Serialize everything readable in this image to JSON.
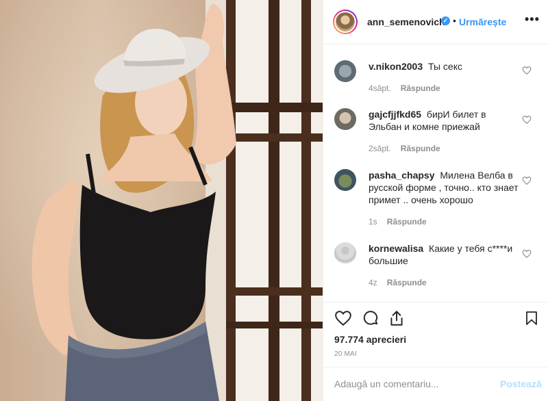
{
  "header": {
    "username": "ann_semenovich",
    "verified_icon": "verified-badge-icon",
    "separator": "•",
    "follow_label": "Urmărește",
    "more_icon": "more-options-icon"
  },
  "comments": [
    {
      "username": "v.nikon2003",
      "text": "Ты секс",
      "time": "4săpt.",
      "reply": "Răspunde"
    },
    {
      "username": "gajcfjjfkd65",
      "text": "бирИ билет в Эльбан и комне приежай",
      "time": "2săpt.",
      "reply": "Răspunde"
    },
    {
      "username": "pasha_chapsy",
      "text": "Милена Велба в русской форме , точно.. кто знает примет .. очень хорошо",
      "time": "1s",
      "reply": "Răspunde"
    },
    {
      "username": "kornewalisa",
      "text": "Какие у тебя с****и большие",
      "time": "4z",
      "reply": "Răspunde"
    }
  ],
  "actions": {
    "likes": "97.774 aprecieri",
    "date": "20 MAI"
  },
  "add_comment": {
    "placeholder": "Adaugă un comentariu...",
    "post_label": "Postează"
  },
  "colors": {
    "link_blue": "#3897f0",
    "post_disabled": "#b2dffc",
    "muted_text": "#8e8e8e"
  }
}
